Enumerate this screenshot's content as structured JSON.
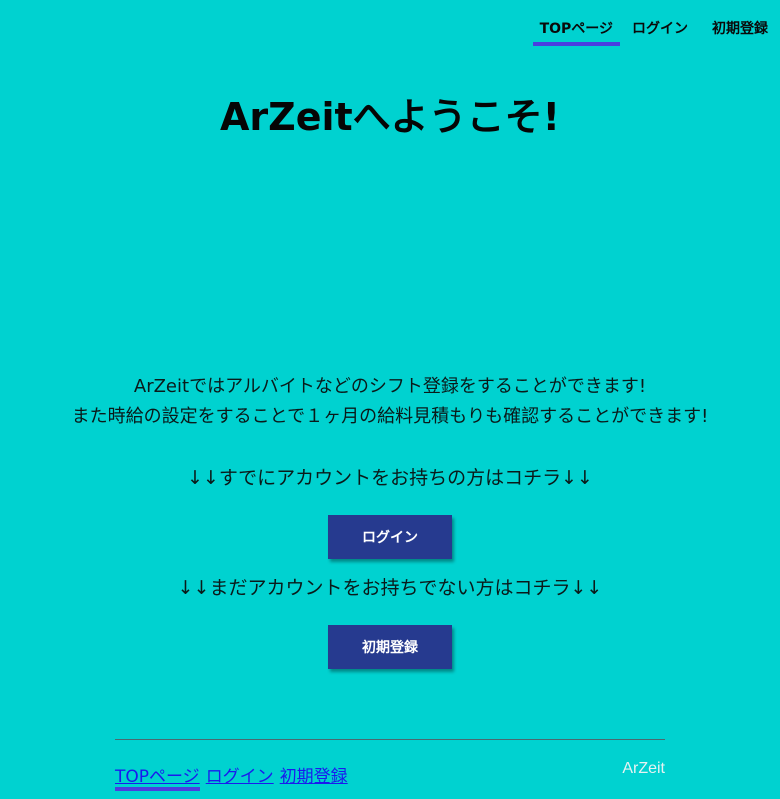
{
  "nav": {
    "items": [
      {
        "label": "TOPページ"
      },
      {
        "label": "ログイン"
      },
      {
        "label": "初期登録"
      }
    ],
    "active_index": 0
  },
  "hero": {
    "title": "ArZeitへようこそ!"
  },
  "intro": {
    "line1": "ArZeitではアルバイトなどのシフト登録をすることができます!",
    "line2": "また時給の設定をすることで１ヶ月の給料見積もりも確認することができます!"
  },
  "login_section": {
    "prompt": "↓↓すでにアカウントをお持ちの方はコチラ↓↓",
    "button_label": "ログイン"
  },
  "register_section": {
    "prompt": "↓↓まだアカウントをお持ちでない方はコチラ↓↓",
    "button_label": "初期登録"
  },
  "footer": {
    "links": [
      {
        "label": "TOPページ"
      },
      {
        "label": "ログイン"
      },
      {
        "label": "初期登録"
      }
    ],
    "brand": "ArZeit"
  },
  "colors": {
    "background": "#00d2d0",
    "button": "#263a8f",
    "active_underline": "#4a3fe0",
    "link": "#1a1aee"
  }
}
